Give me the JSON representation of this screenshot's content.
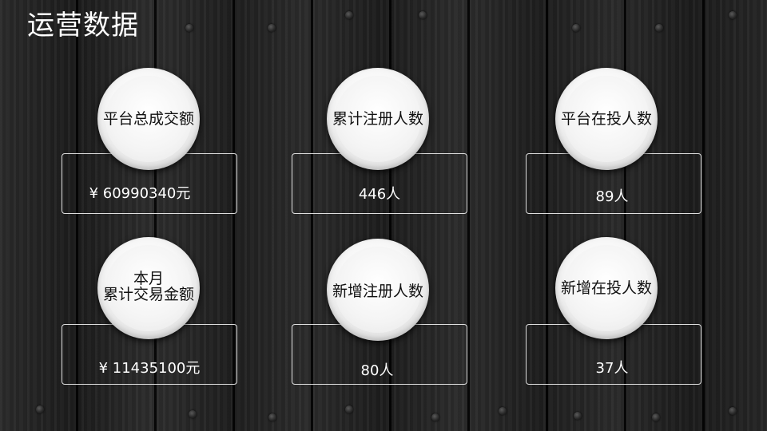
{
  "page": {
    "title": "运营数据"
  },
  "cards": [
    {
      "label": "平台总成交额",
      "value": "¥ 60990340元"
    },
    {
      "label": "累计注册人数",
      "value": "446人"
    },
    {
      "label": "平台在投人数",
      "value": "89人"
    },
    {
      "label_line1": "本月",
      "label_line2": "累计交易金额",
      "value": "¥ 11435100元"
    },
    {
      "label": "新增注册人数",
      "value": "80人"
    },
    {
      "label": "新增在投人数",
      "value": "37人"
    }
  ],
  "colors": {
    "background": "#1e1e1e",
    "text_light": "#ffffff",
    "text_dark": "#111111",
    "plate": "#f4f4f4"
  }
}
